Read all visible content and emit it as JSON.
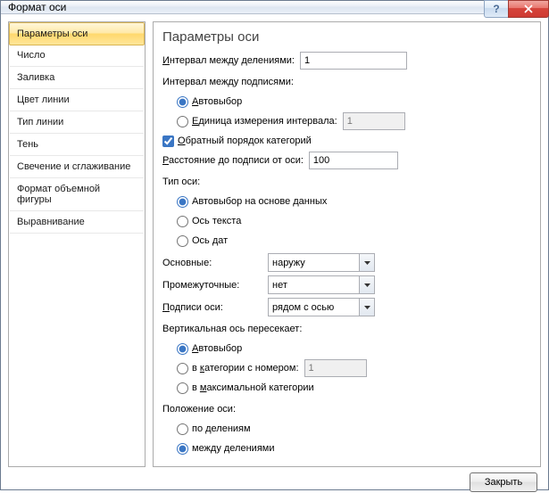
{
  "window": {
    "title": "Формат оси"
  },
  "sidebar": {
    "items": [
      {
        "label": "Параметры оси",
        "selected": true
      },
      {
        "label": "Число"
      },
      {
        "label": "Заливка"
      },
      {
        "label": "Цвет линии"
      },
      {
        "label": "Тип линии"
      },
      {
        "label": "Тень"
      },
      {
        "label": "Свечение и сглаживание"
      },
      {
        "label": "Формат объемной фигуры"
      },
      {
        "label": "Выравнивание"
      }
    ]
  },
  "panel": {
    "heading": "Параметры оси",
    "interval_units_label_pre": "И",
    "interval_units_label_post": "нтервал между делениями:",
    "interval_units_value": "1",
    "interval_labels_label": "Интервал между подписями:",
    "radio_auto_pre": "А",
    "radio_auto_post": "втовыбор",
    "radio_unit_pre": "Е",
    "radio_unit_post": "диница измерения интервала:",
    "radio_unit_value": "1",
    "chk_reverse_pre": "О",
    "chk_reverse_post": "братный порядок категорий",
    "label_distance_pre": "Р",
    "label_distance_post": "асстояние до подписи от оси:",
    "label_distance_value": "100",
    "axis_type_label": "Тип оси:",
    "axis_type_opts": {
      "auto": "Автовыбор на основе данных",
      "text": "Ось текста",
      "date": "Ось дат"
    },
    "tickmarks": {
      "major_label": "Основные:",
      "major_value": "наружу",
      "minor_label": "Промежуточные:",
      "minor_value": "нет",
      "labels_label_pre": "П",
      "labels_label_post": "одписи оси:",
      "labels_value": "рядом с осью"
    },
    "crosses_label": "Вертикальная ось пересекает:",
    "crosses": {
      "auto_pre": "А",
      "auto_post": "втовыбор",
      "at_cat_pre": "в ",
      "at_cat_u": "к",
      "at_cat_post": "атегории с номером:",
      "at_cat_value": "1",
      "at_max_pre": "в ",
      "at_max_u": "м",
      "at_max_post": "аксимальной категории"
    },
    "position_label": "Положение оси:",
    "position": {
      "on_ticks": "по делениям",
      "between_ticks": "между делениями"
    }
  },
  "footer": {
    "close_label": "Закрыть"
  }
}
